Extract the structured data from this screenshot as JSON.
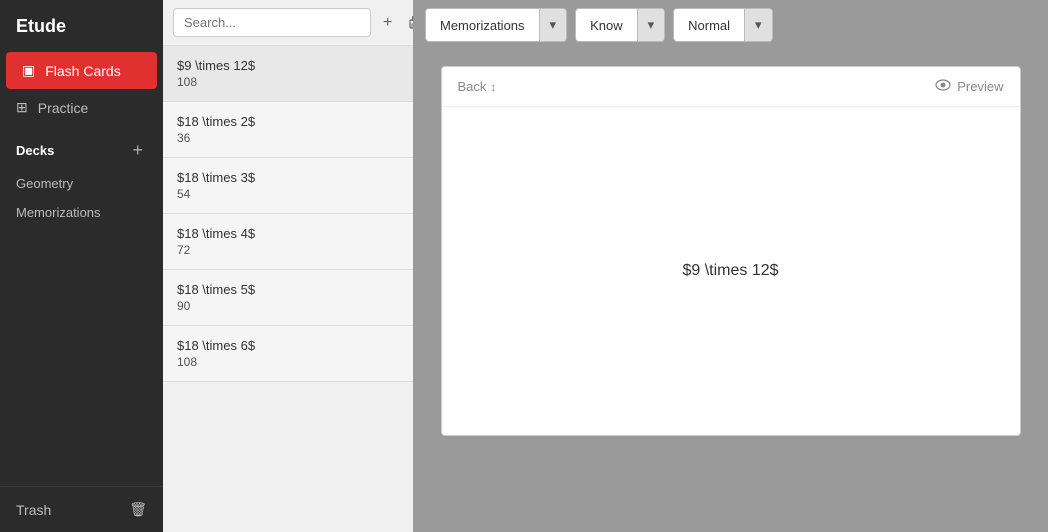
{
  "sidebar": {
    "title": "Etude",
    "flash_cards_label": "Flash Cards",
    "practice_label": "Practice",
    "decks_label": "Decks",
    "geometry_label": "Geometry",
    "memorizations_label": "Memorizations",
    "trash_label": "Trash"
  },
  "card_list": {
    "search_placeholder": "Search...",
    "cards": [
      {
        "front": "$9 \\times 12$",
        "back": "108"
      },
      {
        "front": "$18 \\times 2$",
        "back": "36"
      },
      {
        "front": "$18 \\times 3$",
        "back": "54"
      },
      {
        "front": "$18 \\times 4$",
        "back": "72"
      },
      {
        "front": "$18 \\times 5$",
        "back": "90"
      },
      {
        "front": "$18 \\times 6$",
        "back": "108"
      }
    ]
  },
  "toolbar": {
    "deck_filter_label": "Memorizations",
    "know_filter_label": "Know",
    "mode_label": "Normal"
  },
  "card_preview": {
    "back_label": "Back",
    "preview_label": "Preview",
    "content": "$9 \\times 12$"
  }
}
